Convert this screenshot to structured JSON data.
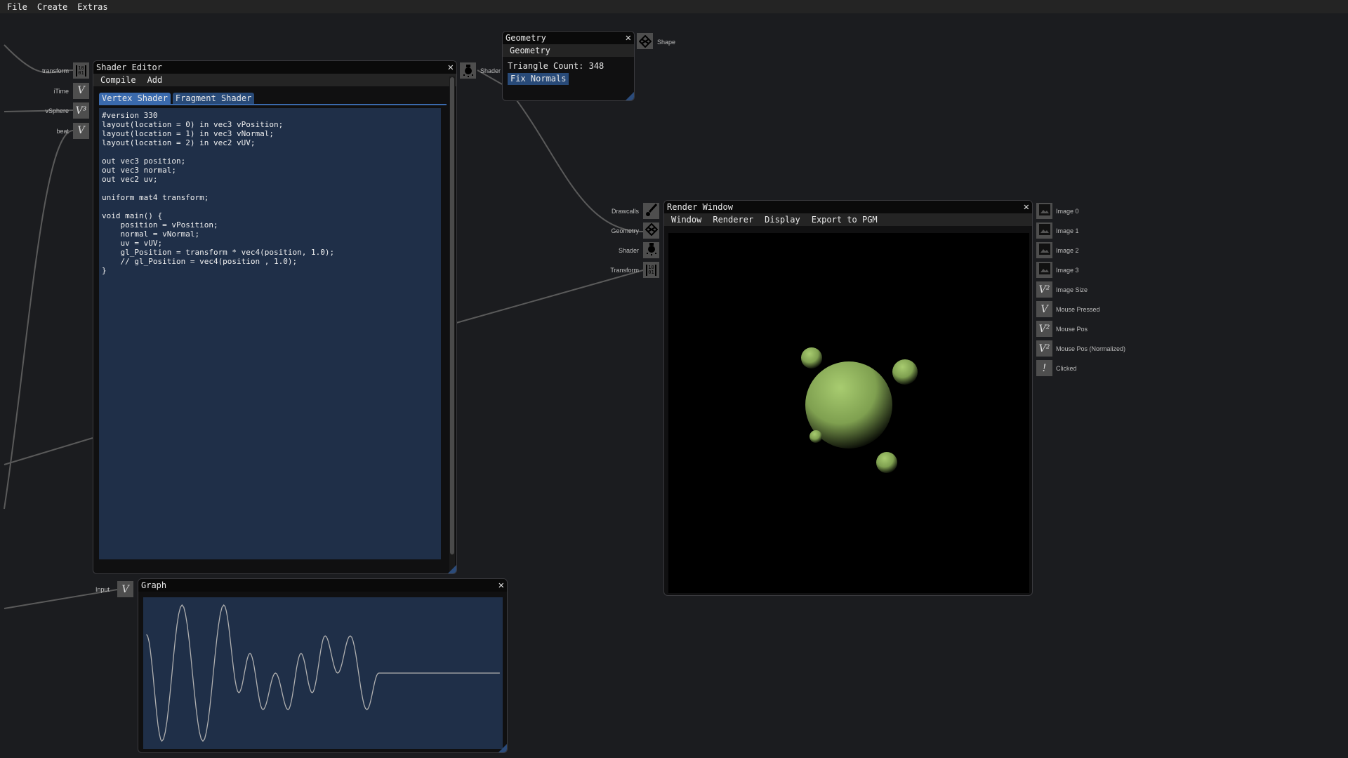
{
  "menu": [
    "File",
    "Create",
    "Extras"
  ],
  "shader_editor": {
    "title": "Shader Editor",
    "menu": [
      "Compile",
      "Add"
    ],
    "tabs": [
      "Vertex Shader",
      "Fragment Shader"
    ],
    "active_tab": "Vertex Shader",
    "code": "#version 330\nlayout(location = 0) in vec3 vPosition;\nlayout(location = 1) in vec3 vNormal;\nlayout(location = 2) in vec2 vUV;\n\nout vec3 position;\nout vec3 normal;\nout vec2 uv;\n\nuniform mat4 transform;\n\nvoid main() {\n    position = vPosition;\n    normal = vNormal;\n    uv = vUV;\n    gl_Position = transform * vec4(position, 1.0);\n    // gl_Position = vec4(position , 1.0);\n}",
    "inputs": [
      {
        "label": "transform",
        "icon": "matrix-icon",
        "glyph": "[10 01]"
      },
      {
        "label": "iTime",
        "icon": "v-icon",
        "glyph": "V"
      },
      {
        "label": "vSphere",
        "icon": "v3-icon",
        "glyph": "V³"
      },
      {
        "label": "beat",
        "icon": "v-icon",
        "glyph": "V"
      }
    ],
    "output": {
      "label": "Shader",
      "icon": "lightbulb-icon"
    }
  },
  "geometry": {
    "title": "Geometry",
    "menu": "Geometry",
    "triangle_count": "Triangle Count: 348",
    "button": "Fix Normals",
    "output": {
      "label": "Shape",
      "icon": "cube-icon"
    }
  },
  "render_window": {
    "title": "Render Window",
    "menu": [
      "Window",
      "Renderer",
      "Display",
      "Export to PGM"
    ],
    "inputs": [
      {
        "label": "Drawcalls",
        "icon": "brush-icon"
      },
      {
        "label": "Geometry",
        "icon": "cube-icon"
      },
      {
        "label": "Shader",
        "icon": "lightbulb-icon"
      },
      {
        "label": "Transform",
        "icon": "matrix-icon"
      }
    ],
    "outputs": [
      {
        "label": "Image 0",
        "icon": "image-icon",
        "glyph": ""
      },
      {
        "label": "Image 1",
        "icon": "image-icon",
        "glyph": ""
      },
      {
        "label": "Image 2",
        "icon": "image-icon",
        "glyph": ""
      },
      {
        "label": "Image 3",
        "icon": "image-icon",
        "glyph": ""
      },
      {
        "label": "Image Size",
        "icon": "v2-icon",
        "glyph": "V²"
      },
      {
        "label": "Mouse Pressed",
        "icon": "v-icon",
        "glyph": "V"
      },
      {
        "label": "Mouse Pos",
        "icon": "v2-icon",
        "glyph": "V²"
      },
      {
        "label": "Mouse Pos (Normalized)",
        "icon": "v2-icon",
        "glyph": "V²"
      },
      {
        "label": "Clicked",
        "icon": "exclamation-icon",
        "glyph": "!"
      }
    ]
  },
  "graph": {
    "title": "Graph",
    "input": {
      "label": "Input",
      "glyph": "V"
    },
    "line_color": "#b0b0b0",
    "background": "#1f2f48",
    "keypoints": [
      [
        0.9,
        0.55
      ],
      [
        5.2,
        -0.97
      ],
      [
        10.8,
        0.97
      ],
      [
        16.6,
        -0.97
      ],
      [
        22.4,
        0.97
      ],
      [
        26.6,
        -0.28
      ],
      [
        29.7,
        0.28
      ],
      [
        33.3,
        -0.52
      ],
      [
        36.8,
        0.0
      ],
      [
        40.3,
        -0.52
      ],
      [
        43.9,
        0.28
      ],
      [
        47.0,
        -0.28
      ],
      [
        50.6,
        0.53
      ],
      [
        54.1,
        0.0
      ],
      [
        57.6,
        0.53
      ],
      [
        62.2,
        -0.52
      ],
      [
        65.5,
        0.0
      ],
      [
        99.2,
        0.0
      ]
    ],
    "xlim": [
      0,
      100
    ],
    "ylim": [
      -1,
      1
    ]
  },
  "colors": {
    "accent": "#3a6aad",
    "code_bg": "#1f2f48",
    "sphere": "#a8cc70"
  }
}
